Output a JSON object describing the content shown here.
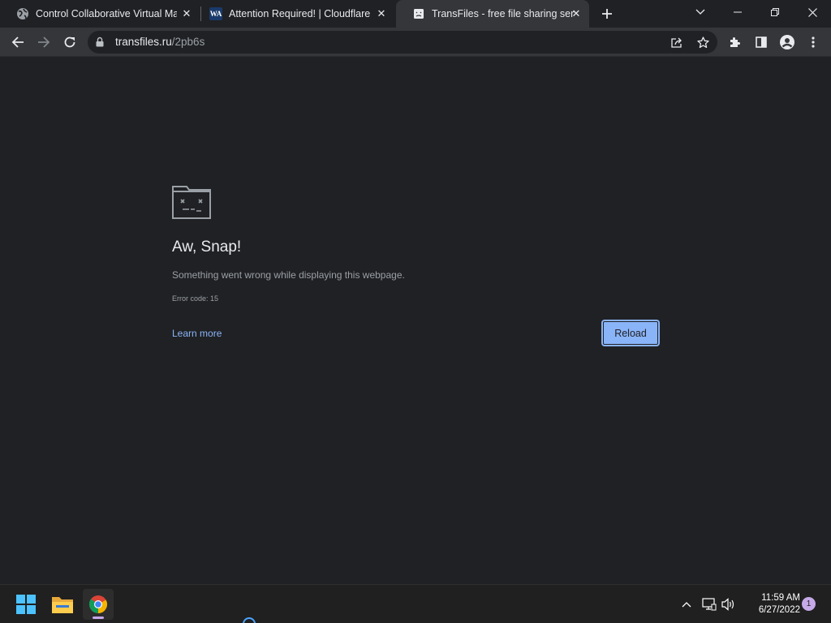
{
  "browser": {
    "tabs": [
      {
        "title": "Control Collaborative Virtual Mac",
        "favicon": "globe-icon",
        "active": false
      },
      {
        "title": "Attention Required! | Cloudflare",
        "favicon": "wa-logo-icon",
        "favicon_text": "WA",
        "active": false
      },
      {
        "title": "TransFiles - free file sharing servic",
        "favicon": "sad-tab-icon",
        "active": true
      }
    ],
    "address_bar": {
      "domain": "transfiles.ru",
      "path": "/2pb6s"
    }
  },
  "error_page": {
    "title": "Aw, Snap!",
    "description": "Something went wrong while displaying this webpage.",
    "error_code": "Error code: 15",
    "learn_more": "Learn more",
    "reload_label": "Reload"
  },
  "taskbar": {
    "time": "11:59 AM",
    "date": "6/27/2022",
    "notification_count": "1"
  },
  "colors": {
    "page_bg": "#202124",
    "toolbar_bg": "#35363a",
    "link": "#8ab4f8",
    "button_bg": "#8ab4f8"
  }
}
